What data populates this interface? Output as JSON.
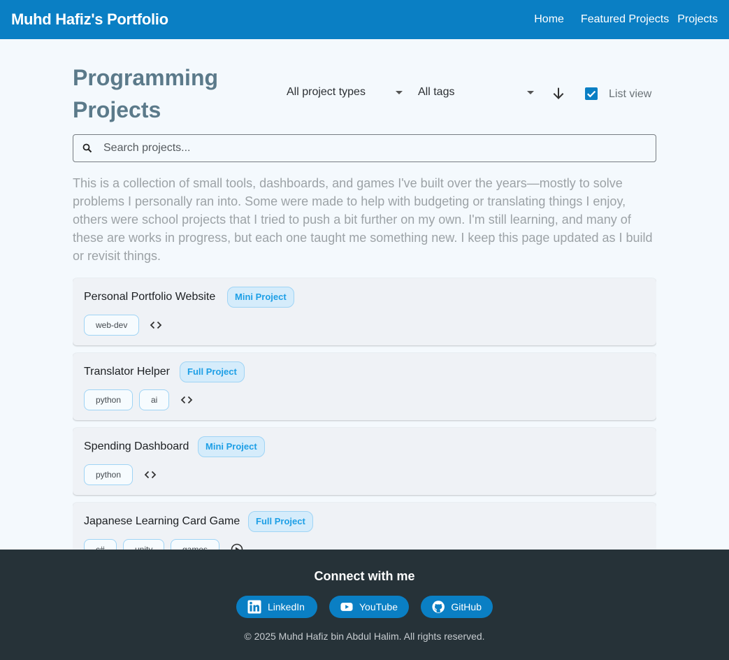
{
  "header": {
    "brand": "Muhd Hafiz's Portfolio",
    "nav": [
      "Home",
      "Featured Projects",
      "Projects"
    ]
  },
  "page": {
    "title": "Programming Projects",
    "filters": {
      "type_selected": "All project types",
      "tags_selected": "All tags",
      "sort_icon": "arrow-down-icon",
      "list_view_checked": true,
      "list_view_label": "List view"
    },
    "search": {
      "placeholder": "Search projects...",
      "value": ""
    },
    "intro": "This is a collection of small tools, dashboards, and games I've built over the years—mostly to solve problems I personally ran into. Some were made to help with budgeting or translating things I enjoy, others were school projects that I tried to push a bit further on my own. I'm still learning, and many of these are works in progress, but each one taught me something new. I keep this page updated as I build or revisit things."
  },
  "projects": [
    {
      "title": "Personal Portfolio Website",
      "badge": "Mini Project",
      "tags": [
        "web-dev"
      ],
      "action_icon": "code-icon"
    },
    {
      "title": "Translator Helper",
      "badge": "Full Project",
      "tags": [
        "python",
        "ai"
      ],
      "action_icon": "code-icon"
    },
    {
      "title": "Spending Dashboard",
      "badge": "Mini Project",
      "tags": [
        "python"
      ],
      "action_icon": "code-icon"
    },
    {
      "title": "Japanese Learning Card Game",
      "badge": "Full Project",
      "tags": [
        "c#",
        "unity",
        "games"
      ],
      "action_icon": "play-circle-icon"
    }
  ],
  "footer": {
    "title": "Connect with me",
    "links": [
      {
        "label": "LinkedIn",
        "icon": "linkedin-icon"
      },
      {
        "label": "YouTube",
        "icon": "youtube-icon"
      },
      {
        "label": "GitHub",
        "icon": "github-icon"
      }
    ],
    "copyright": "© 2025 Muhd Hafiz bin Abdul Halim. All rights reserved."
  },
  "colors": {
    "primary": "#0a7fc4",
    "badge_text": "#1d9fe6",
    "footer_bg": "#263238",
    "page_bg": "#f4f9fd"
  }
}
